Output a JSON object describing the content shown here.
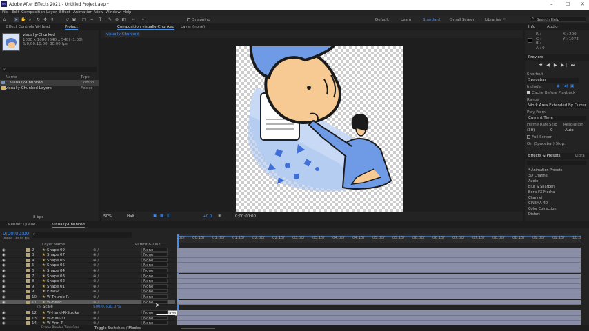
{
  "app": {
    "title": "Adobe After Effects 2021 - Untitled Project.aep *"
  },
  "menu": [
    "File",
    "Edit",
    "Composition",
    "Layer",
    "Effect",
    "Animation",
    "View",
    "Window",
    "Help"
  ],
  "toolbar": {
    "snapping": "Snapping",
    "workspaces": [
      "Default",
      "Learn",
      "Standard",
      "Small Screen",
      "Libraries"
    ],
    "search": "Search Help"
  },
  "project": {
    "tabs": {
      "effect_controls": "Effect Controls W-Head",
      "project": "Project"
    },
    "comp_name": "visually-Chunked",
    "comp_size": "1080 x 1080 (540 x 540) (1.00)",
    "comp_duration": "Δ 0;00:10:00, 30.00 fps",
    "columns": {
      "name": "Name",
      "type": "Type"
    },
    "items": [
      {
        "name": "visually-Chunked",
        "type": "Compo"
      },
      {
        "name": "visually-Chunked Layers",
        "type": "Folder"
      }
    ],
    "bpc": "8 bpc"
  },
  "composition": {
    "tab_label": "Composition visually-Chunked",
    "layer_tab": "Layer (none)",
    "breadcrumb": "visually-Chunked",
    "zoom": "50%",
    "quality": "Half",
    "exposure": "+0.0",
    "timecode": "0;00:00;00"
  },
  "info": {
    "tabs": [
      "Info",
      "Audio"
    ],
    "r": "R :",
    "g": "G :",
    "b": "B :",
    "a": "A : 0",
    "x": "X : 200",
    "y": "Y : 1073"
  },
  "preview": {
    "title": "Preview",
    "shortcut_label": "Shortcut",
    "shortcut": "Spacebar",
    "include": "Include:",
    "cache": "Cache Before Playback",
    "range_label": "Range",
    "range": "Work Area Extended By Current...",
    "playfrom_label": "Play From",
    "playfrom": "Current Time",
    "framerate_label": "Frame Rate",
    "skip_label": "Skip",
    "resolution_label": "Resolution",
    "framerate": "(30)",
    "skip": "0",
    "resolution": "Auto",
    "fullscreen": "Full Screen",
    "stop": "On (Spacebar) Stop:"
  },
  "effects": {
    "tabs": [
      "Effects & Presets",
      "Libra"
    ],
    "items": [
      "* Animation Presets",
      "3D Channel",
      "Audio",
      "Blur & Sharpen",
      "Boris FX Mocha",
      "Channel",
      "CINEMA 4D",
      "Color Correction",
      "Distort"
    ]
  },
  "timeline": {
    "tabs": [
      "Render Queue",
      "visually-Chunked"
    ],
    "timecode": "0:00:00:00",
    "timecode_sub": "00000 (30.00 fps)",
    "col_layer": "Layer Name",
    "col_parent": "Parent & Link",
    "ruler": [
      "00f",
      "00:15f",
      "01:00f",
      "01:15f",
      "02:00f",
      "02:15f",
      "03:00f",
      "03:15f",
      "04:00f",
      "04:15f",
      "05:00f",
      "05:15f",
      "06:00f",
      "06:15f",
      "07:00f",
      "07:15f",
      "08:00f",
      "08:15f",
      "09:00f",
      "09:15f",
      "10:0"
    ],
    "layers": [
      {
        "num": "2",
        "name": "Shape 09",
        "parent": "None"
      },
      {
        "num": "3",
        "name": "Shape 07",
        "parent": "None"
      },
      {
        "num": "4",
        "name": "Shape 06",
        "parent": "None"
      },
      {
        "num": "5",
        "name": "Shape 05",
        "parent": "None"
      },
      {
        "num": "6",
        "name": "Shape 04",
        "parent": "None"
      },
      {
        "num": "7",
        "name": "Shape 03",
        "parent": "None"
      },
      {
        "num": "8",
        "name": "Shape 02",
        "parent": "None"
      },
      {
        "num": "9",
        "name": "Shape 01",
        "parent": "None"
      },
      {
        "num": "9",
        "name": "E Bow",
        "parent": "None"
      },
      {
        "num": "10",
        "name": "W-Thumb-R",
        "parent": "None"
      },
      {
        "num": "11",
        "name": "W-Head",
        "parent": "None"
      }
    ],
    "scale_label": "Scale",
    "scale_value": "500.0,500.0 %",
    "layers2": [
      {
        "num": "12",
        "name": "W-Hand-R-Stroke",
        "parent": "None"
      },
      {
        "num": "13",
        "name": "W-Hair-01",
        "parent": "None"
      },
      {
        "num": "14",
        "name": "W-Arm-R",
        "parent": "None"
      }
    ],
    "tooltip": "Select layer from which to inherit transforms",
    "toggle": "Toggle Switches / Modes",
    "frame_render": "Frame Render Time 0ms"
  }
}
